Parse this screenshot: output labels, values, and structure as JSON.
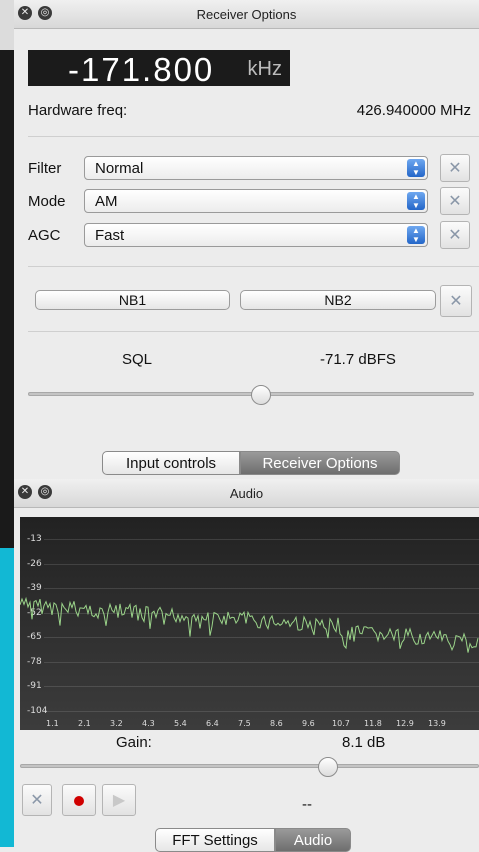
{
  "receiver": {
    "title": "Receiver Options",
    "offset_value": "-171.800",
    "offset_unit": "kHz",
    "hw_label": "Hardware freq:",
    "hw_value": "426.940000 MHz",
    "filter_label": "Filter",
    "filter_value": "Normal",
    "mode_label": "Mode",
    "mode_value": "AM",
    "agc_label": "AGC",
    "agc_value": "Fast",
    "nb1_label": "NB1",
    "nb2_label": "NB2",
    "sql_label": "SQL",
    "sql_value": "-71.7 dBFS"
  },
  "tabs_top": [
    "Input controls",
    "Receiver Options"
  ],
  "audio": {
    "title": "Audio",
    "y_ticks": [
      "-13",
      "-26",
      "-39",
      "-52",
      "-65",
      "-78",
      "-91",
      "-104"
    ],
    "x_ticks": [
      "1.1",
      "2.1",
      "3.2",
      "4.3",
      "5.4",
      "6.4",
      "7.5",
      "8.6",
      "9.6",
      "10.7",
      "11.8",
      "12.9",
      "13.9"
    ],
    "gain_label": "Gain:",
    "gain_value": "8.1 dB",
    "status_text": "--"
  },
  "tabs_bottom": [
    "FFT Settings",
    "Audio"
  ],
  "colors": {
    "spectrum_line": "#9bd48a",
    "record": "#d00000",
    "accent_blue": "#2f6fd0"
  },
  "icons": {
    "close": "close-icon",
    "window": "window-icon",
    "tools": "wrench-screwdriver-icon"
  }
}
